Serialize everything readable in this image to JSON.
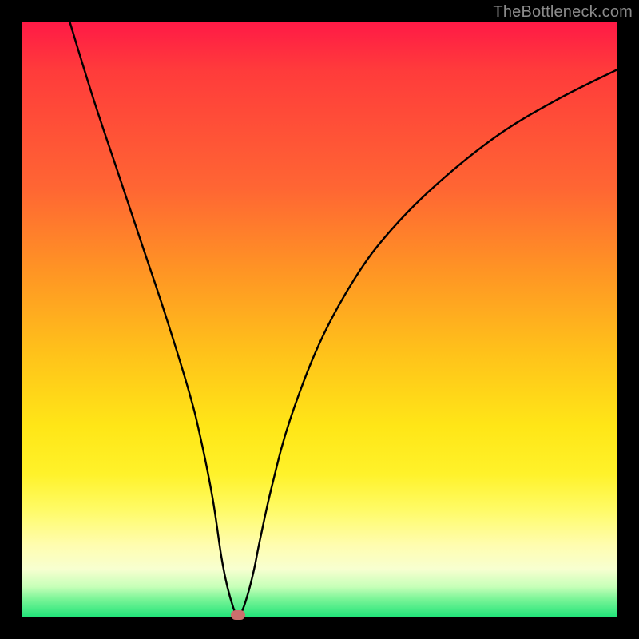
{
  "watermark": "TheBottleneck.com",
  "marker": {
    "color": "#cc6f6d"
  },
  "chart_data": {
    "type": "line",
    "title": "",
    "xlabel": "",
    "ylabel": "",
    "xlim": [
      0,
      100
    ],
    "ylim": [
      0,
      100
    ],
    "grid": false,
    "series": [
      {
        "name": "curve",
        "x": [
          8,
          12,
          16,
          20,
          24,
          28,
          30,
          32,
          33.5,
          34.5,
          35.5,
          36,
          36.5,
          37,
          38,
          39,
          40,
          42,
          45,
          50,
          56,
          62,
          70,
          80,
          90,
          100
        ],
        "y": [
          100,
          87,
          75,
          63,
          51,
          38,
          30,
          20,
          10,
          5,
          1.5,
          0.5,
          0.5,
          1,
          4,
          8,
          13,
          22,
          33,
          46,
          57,
          65,
          73,
          81,
          87,
          92
        ]
      }
    ],
    "marker_point": {
      "x": 36.3,
      "y": 0.3
    }
  }
}
